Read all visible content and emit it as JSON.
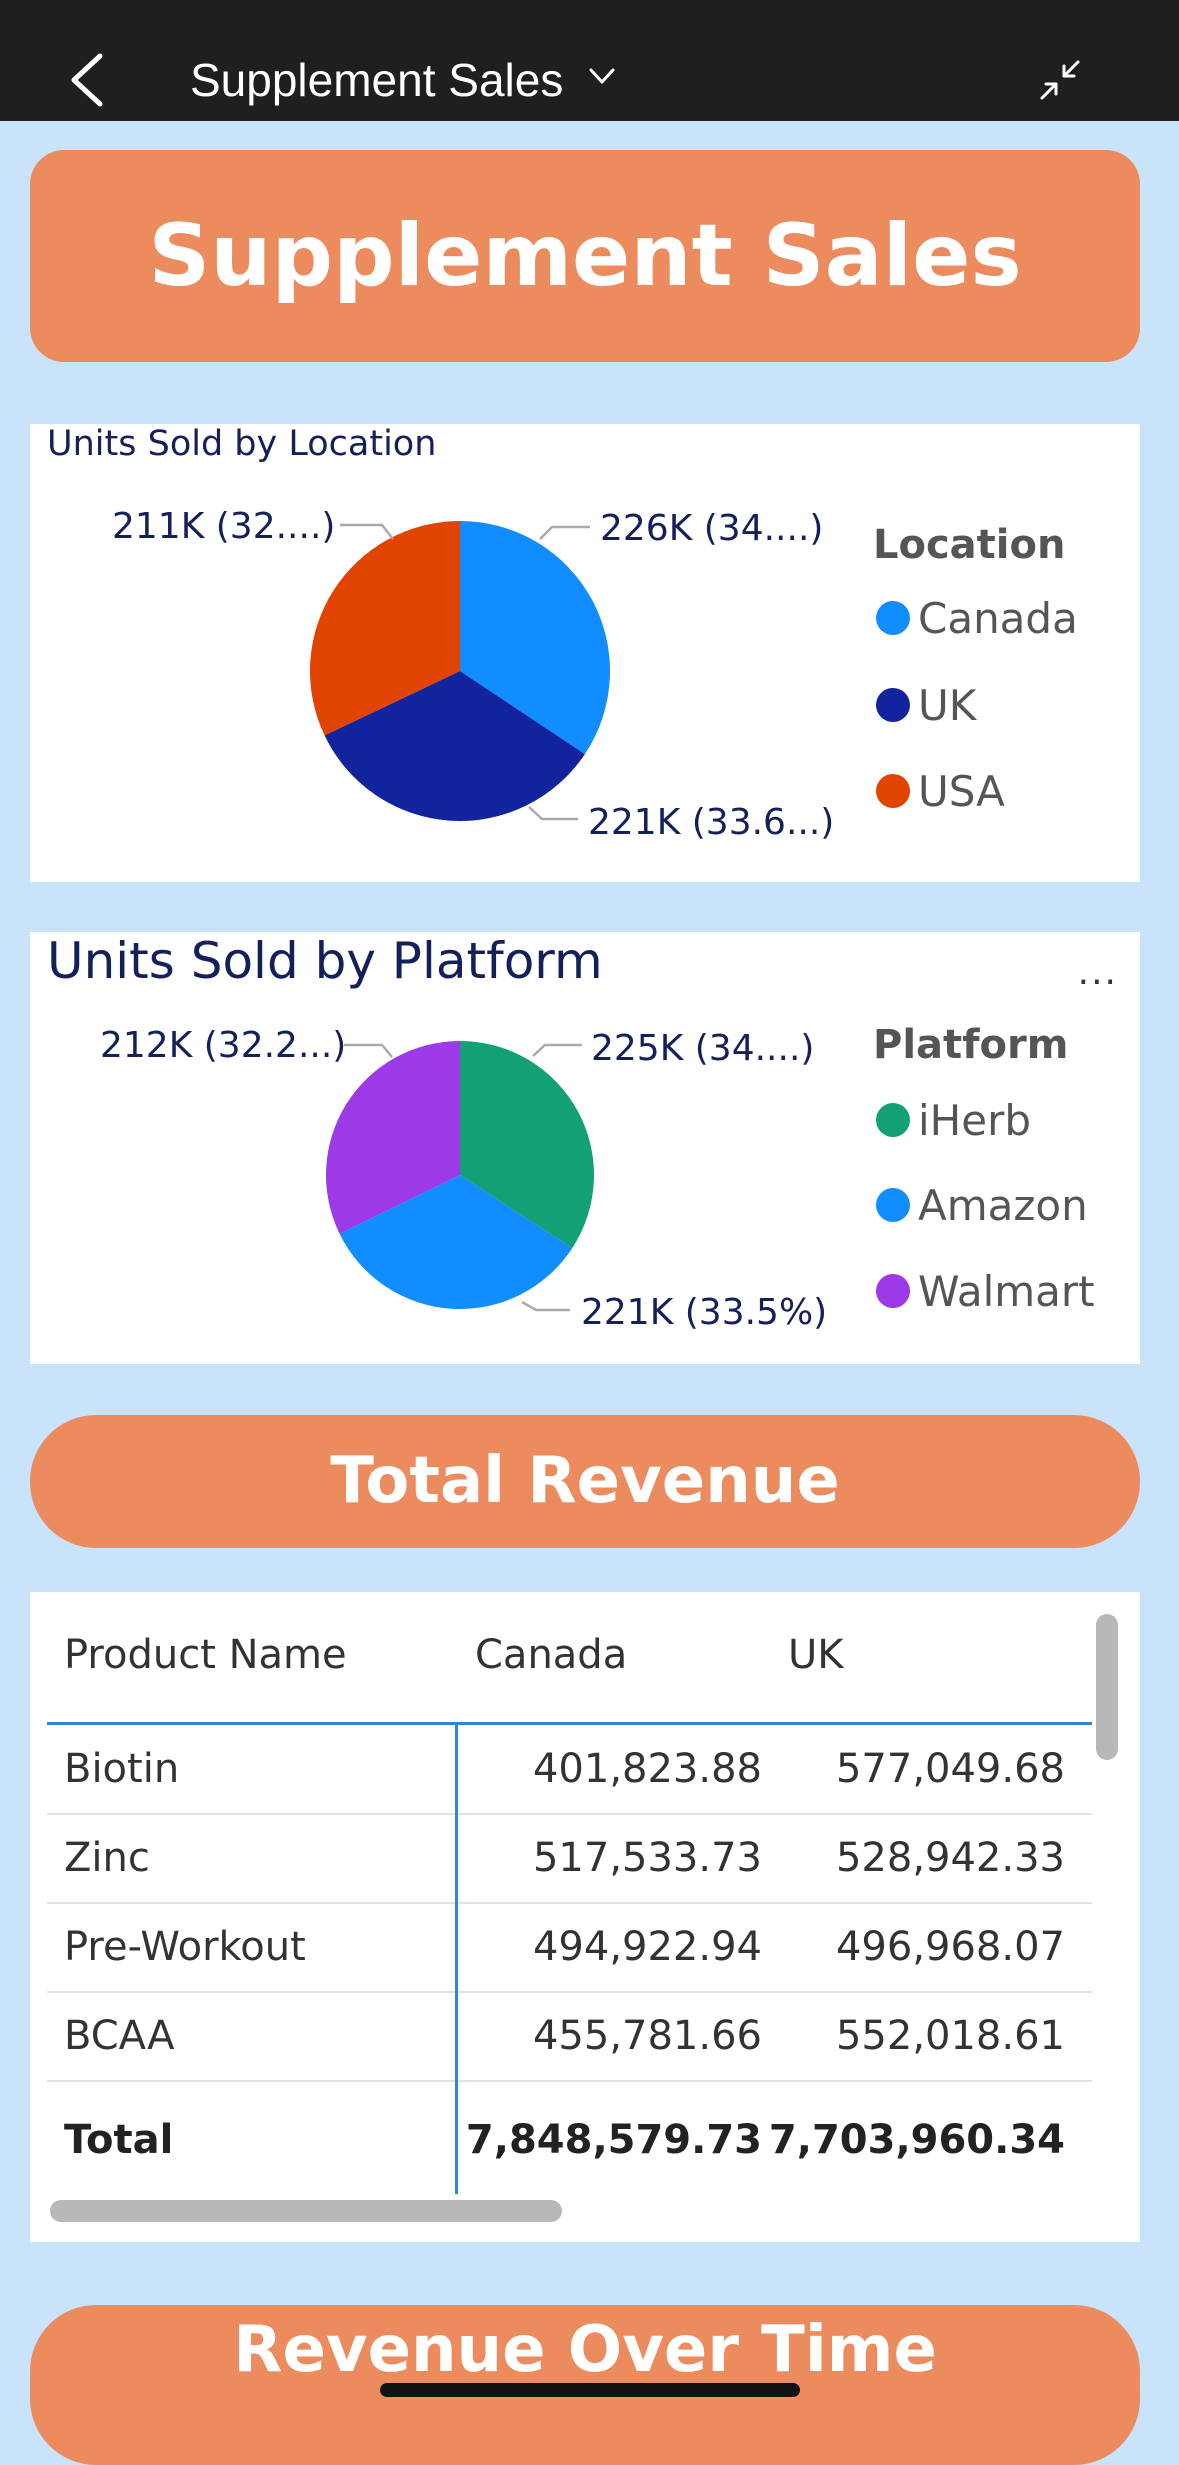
{
  "topbar": {
    "title": "Supplement Sales"
  },
  "banner": {
    "title": "Supplement Sales"
  },
  "location_card": {
    "title": "Units Sold by Location",
    "legend_title": "Location",
    "legend": [
      "Canada",
      "UK",
      "USA"
    ],
    "labels": [
      "226K (34....)",
      "221K (33.6...)",
      "211K (32....)"
    ],
    "colors": [
      "#118dff",
      "#12239e",
      "#e04400"
    ]
  },
  "platform_card": {
    "title": "Units Sold by Platform",
    "more": "...",
    "legend_title": "Platform",
    "legend": [
      "iHerb",
      "Amazon",
      "Walmart"
    ],
    "labels": [
      "225K (34....)",
      "221K (33.5%)",
      "212K (32.2...)"
    ],
    "colors": [
      "#13a075",
      "#118dff",
      "#9b3ae6"
    ]
  },
  "revenue_banner": {
    "title": "Total Revenue"
  },
  "revenue_table": {
    "headers": [
      "Product Name",
      "Canada",
      "UK"
    ],
    "rows": [
      {
        "name": "Biotin",
        "canada": "401,823.88",
        "uk": "577,049.68"
      },
      {
        "name": "Zinc",
        "canada": "517,533.73",
        "uk": "528,942.33"
      },
      {
        "name": "Pre-Workout",
        "canada": "494,922.94",
        "uk": "496,968.07"
      },
      {
        "name": "BCAA",
        "canada": "455,781.66",
        "uk": "552,018.61"
      }
    ],
    "total": {
      "name": "Total",
      "canada": "7,848,579.73",
      "uk": "7,703,960.34"
    }
  },
  "time_banner": {
    "title": "Revenue Over Time"
  },
  "chart_data": [
    {
      "type": "pie",
      "title": "Units Sold by Location",
      "legend_title": "Location",
      "categories": [
        "Canada",
        "UK",
        "USA"
      ],
      "values": [
        226000,
        221000,
        211000
      ],
      "value_labels": [
        "226K (34....)",
        "221K (33.6...)",
        "211K (32....)"
      ]
    },
    {
      "type": "pie",
      "title": "Units Sold by Platform",
      "legend_title": "Platform",
      "categories": [
        "iHerb",
        "Amazon",
        "Walmart"
      ],
      "values": [
        225000,
        221000,
        212000
      ],
      "value_labels": [
        "225K (34....)",
        "221K (33.5%)",
        "212K (32.2...)"
      ]
    }
  ]
}
